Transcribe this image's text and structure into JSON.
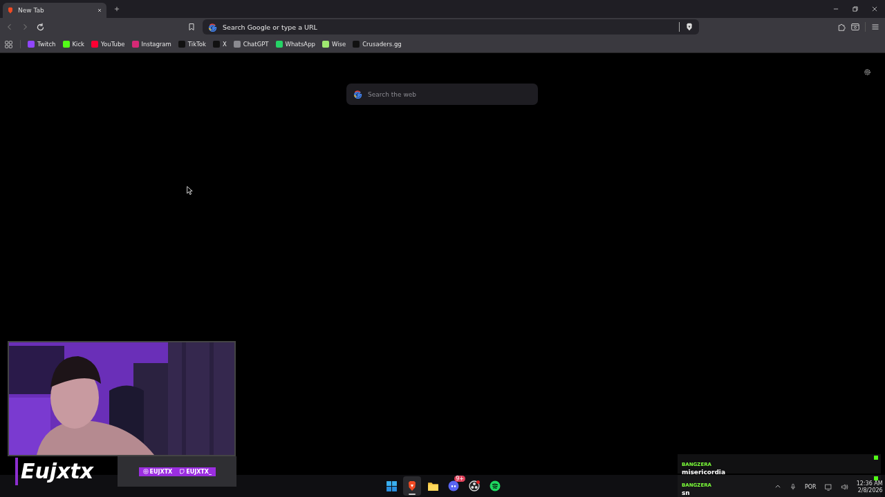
{
  "tabs": [
    {
      "title": "New Tab",
      "selected": true
    }
  ],
  "address_bar": {
    "placeholder": "Search Google or type a URL"
  },
  "bookmarks": [
    {
      "label": "Twitch",
      "color": "#9146ff"
    },
    {
      "label": "Kick",
      "color": "#53fc18"
    },
    {
      "label": "YouTube",
      "color": "#ff0033"
    },
    {
      "label": "Instagram",
      "color": "#d62976"
    },
    {
      "label": "TikTok",
      "color": "#111111"
    },
    {
      "label": "X",
      "color": "#111111"
    },
    {
      "label": "ChatGPT",
      "color": "#8a8a90"
    },
    {
      "label": "WhatsApp",
      "color": "#25d366"
    },
    {
      "label": "Wise",
      "color": "#9fe870"
    },
    {
      "label": "Crusaders.gg",
      "color": "#111111"
    }
  ],
  "search": {
    "placeholder": "Search the web"
  },
  "overlay": {
    "logo": "Eujxtx",
    "handles": [
      "EUJXTX",
      "EUJXTX_"
    ]
  },
  "chat": [
    {
      "user": "BANGZERA",
      "message": "misericordia"
    },
    {
      "user": "BANGZERA",
      "message": "sn"
    }
  ],
  "taskbar": {
    "apps": [
      {
        "kind": "start",
        "selected": false
      },
      {
        "kind": "brave",
        "selected": true
      },
      {
        "kind": "files",
        "selected": false
      },
      {
        "kind": "discord",
        "selected": false,
        "badge": "9+"
      },
      {
        "kind": "obs",
        "selected": false
      },
      {
        "kind": "spotify",
        "selected": false
      }
    ],
    "language": "POR",
    "time": "12:36 AM",
    "date": "2/8/2026"
  }
}
